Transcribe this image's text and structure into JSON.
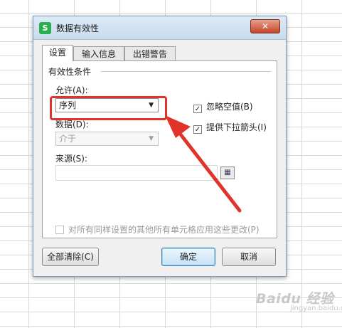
{
  "dialog": {
    "title": "数据有效性",
    "app_icon_letter": "S",
    "close_label": "✕"
  },
  "tabs": [
    {
      "label": "设置",
      "active": true
    },
    {
      "label": "输入信息",
      "active": false
    },
    {
      "label": "出错警告",
      "active": false
    }
  ],
  "criteria": {
    "section_title": "有效性条件",
    "allow_label": "允许(A):",
    "allow_value": "序列",
    "data_label": "数据(D):",
    "data_value": "介于",
    "source_label": "来源(S):",
    "source_value": ""
  },
  "options": {
    "ignore_blank": {
      "label": "忽略空值(B)",
      "checked": true
    },
    "dropdown_arrow": {
      "label": "提供下拉箭头(I)",
      "checked": true
    },
    "apply_all": {
      "label": "对所有同样设置的其他所有单元格应用这些更改(P)",
      "checked": false
    }
  },
  "buttons": {
    "clear_all": "全部清除(C)",
    "ok": "确定",
    "cancel": "取消"
  },
  "watermark": {
    "main": "Baidu 经验",
    "sub": "jingyan.baidu.com"
  },
  "colors": {
    "annotation": "#e0342a",
    "app_icon": "#2bae50",
    "close_button": "#c6452a"
  }
}
